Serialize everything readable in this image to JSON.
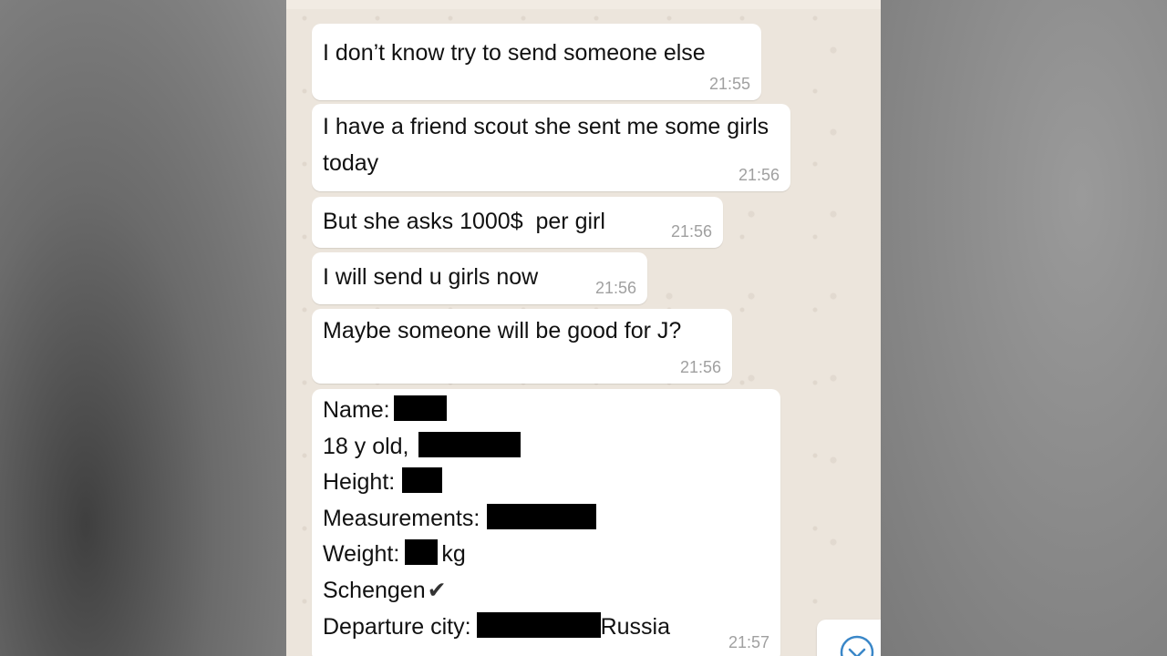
{
  "messages": [
    {
      "text": "I don’t know try to send someone else",
      "time": "21:55"
    },
    {
      "text": "I have a friend scout she sent me some girls today",
      "time": "21:56"
    },
    {
      "text": "But she asks 1000$  per girl",
      "time": "21:56"
    },
    {
      "text": "I will send u girls now",
      "time": "21:56"
    },
    {
      "text": "Maybe someone will be good for J?",
      "time": "21:56"
    }
  ],
  "profile": {
    "name_label": "Name:",
    "age_label": "18 y old,",
    "height_label": "Height:",
    "measurements_label": "Measurements:",
    "weight_label": "Weight:",
    "weight_unit": "kg",
    "schengen_label": "Schengen",
    "check_glyph": "✔",
    "departure_label": "Departure city:",
    "departure_country": "Russia",
    "time": "21:57"
  },
  "icons": {
    "scroll_down": "chevron-down-icon"
  },
  "colors": {
    "chat_background": "#ece5dc",
    "bubble": "#ffffff",
    "timestamp": "#a0a0a0",
    "redaction": "#000000"
  }
}
